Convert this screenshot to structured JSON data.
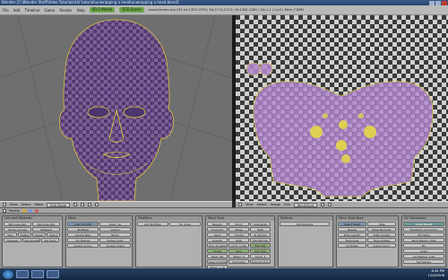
{
  "window": {
    "title": "Blender [C:\\Blender Stuff\\Video Tutorials\\UV tutorial\\unwrapping a head\\unwrapping a head.blend]"
  },
  "menubar": {
    "items": [
      "File",
      "Add",
      "Timeline",
      "Game",
      "Render",
      "Help"
    ],
    "screen": "SR:2-Model",
    "scene": "SCE:Scene",
    "stats": "www.blender.org 245  Ve:1353-1353 | Ed:2713-2713 | Fa:1361-1361 | Ob:1-1 | La:0 | Mem:7.88M"
  },
  "viewport3d": {
    "header_items": [
      "View",
      "Select",
      "Mesh"
    ],
    "mode": "Edit Mode",
    "colors": {
      "bg": "#6f6f6f",
      "mesh_a": "#7a5a9a",
      "mesh_b": "#4d3670",
      "wire": "#d8c23a"
    }
  },
  "uv_editor": {
    "header_items": [
      "View",
      "Select",
      "Image",
      "UVs"
    ],
    "image_name": "IM:UVGrid",
    "colors": {
      "check_light": "#cfcfcf",
      "check_dark": "#3a3a3a",
      "uv_fill": "#b58ad0",
      "uv_wire": "#e8dd40"
    }
  },
  "properties": {
    "header_items": [
      "Panels"
    ],
    "panels": [
      {
        "title": "Link and Materials",
        "buttons": [
          "ME:Cube.001",
          "OB:Cube.001",
          "Vertex Groups",
          "Material",
          "New",
          "Delete",
          "Assign",
          "Select",
          "Deselect",
          "Set Smooth",
          "Set Solid"
        ]
      },
      {
        "title": "Mesh",
        "buttons": [
          "Auto Smooth",
          "Degr: 30",
          "TexMesh",
          "Centre",
          "Centre New",
          "Sticky",
          "UV Texture",
          "Vertex Color",
          "Centre Cursor",
          "Double Sided"
        ]
      },
      {
        "title": "Modifiers",
        "buttons": [
          "Add Modifier",
          "To: Cube"
        ]
      },
      {
        "title": "Mesh Tools",
        "buttons": [
          "Beauty",
          "Short",
          "Subdivide",
          "Innervert",
          "Noise",
          "Hash",
          "Xsort",
          "Fractal",
          "To Sphere",
          "Smooth",
          "Split",
          "Flip Normal",
          "Rem Doubles",
          "Limit: 0.001",
          "Extrude",
          "Screw",
          "Spin",
          "Spin Dup",
          "Degr: 90",
          "Steps: 9",
          "Turns: 1",
          "Keep Original",
          "Clockwise",
          "Extrude Dup",
          "Offset: 1.00"
        ]
      },
      {
        "title": "Multires",
        "buttons": [
          "Add Multires"
        ]
      },
      {
        "title": "Mesh Tools More",
        "buttons": [
          "Select Swap",
          "Hide",
          "Reveal",
          "Edge Normals",
          "Edge Length",
          "Edge Angles",
          "Face Area",
          "Face Angles",
          "All Edges",
          "X-axis mirror"
        ]
      },
      {
        "title": "UV Calculation",
        "buttons": [
          "Angle Based",
          "Transform Correction",
          "Fill Holes",
          "Pack Margin: 0.00",
          "Pin",
          "Unpin",
          "Cyl Radius: 1.00",
          "Set Sphere"
        ]
      }
    ]
  },
  "taskbar": {
    "time": "6:44 PM",
    "date": "12/6/2008"
  }
}
